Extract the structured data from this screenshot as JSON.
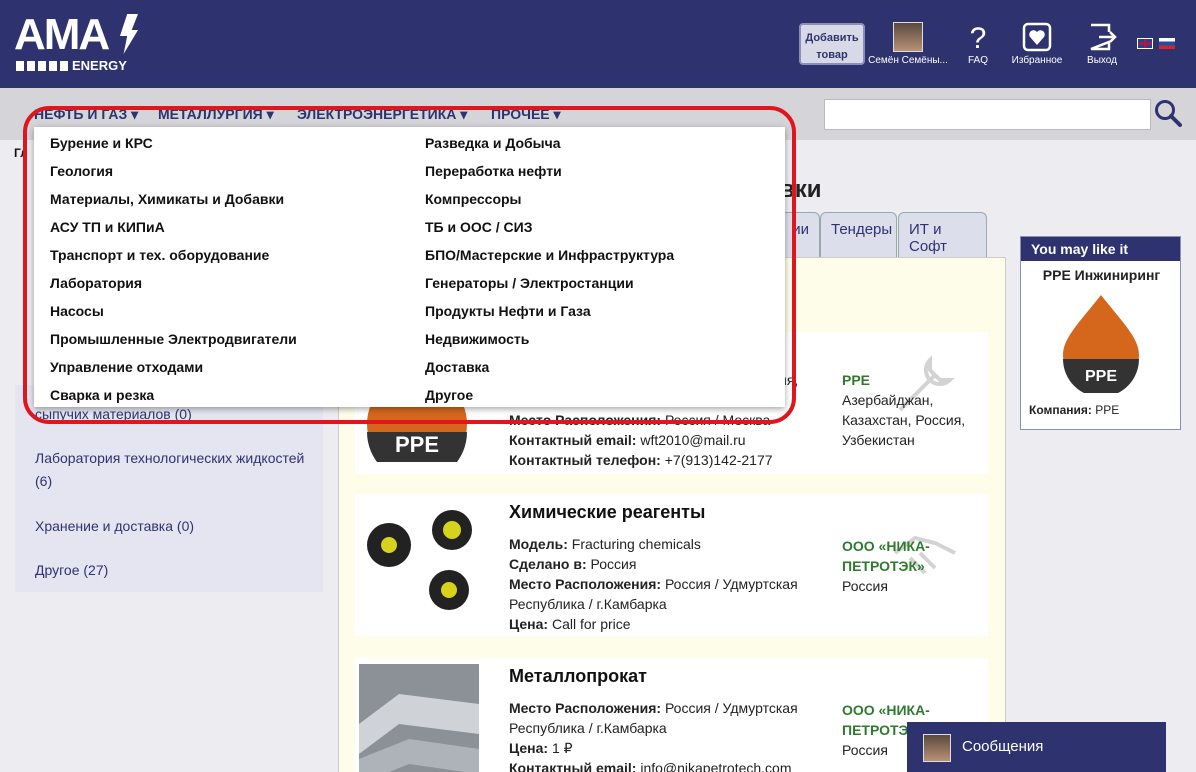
{
  "header": {
    "logo_text": "AMA",
    "logo_sub": "ENERGY",
    "add_product": "Добавить товар",
    "user_name": "Семён Семёны...",
    "faq": "FAQ",
    "favorites": "Избранное",
    "logout": "Выход",
    "colors": {
      "bg": "#2e3370"
    }
  },
  "nav": {
    "items": [
      "НЕФТЬ И ГАЗ",
      "МЕТАЛЛУРГИЯ",
      "ЭЛЕКТРОЭНЕРГЕТИКА",
      "ПРОЧЕЕ"
    ],
    "search_value": ""
  },
  "breadcrumb": "Гл",
  "dropdown": {
    "left": [
      "Бурение и КРС",
      "Геология",
      "Материалы, Химикаты и Добавки",
      "АСУ ТП и КИПиА",
      "Транспорт и тех. оборудование",
      "Лаборатория",
      "Насосы",
      "Промышленные Электродвигатели",
      "Управление отходами",
      "Сварка и резка"
    ],
    "right": [
      "Разведка и Добыча",
      "Переработка нефти",
      "Компрессоры",
      "ТБ и ООС / СИЗ",
      "БПО/Мастерские и Инфраструктура",
      "Генераторы / Электростанции",
      "Продукты Нефти и Газа",
      "Недвижимость",
      "Доставка",
      "Другое"
    ]
  },
  "sidebar": {
    "items": [
      "сыпучих материалов (0)",
      "Лаборатория технологических жидкостей (6)",
      "Хранение и доставка (0)",
      "Другое (27)"
    ]
  },
  "main": {
    "title_fragment": "вки",
    "tab_fragment": "ии",
    "tabs": [
      "Тендеры",
      "ИТ и Софт"
    ]
  },
  "cards": [
    {
      "title": "",
      "country_fragment": "ссия,",
      "fields": [
        {
          "label": "Место Расположения:",
          "value": "Россия / Москва"
        },
        {
          "label": "Контактный email:",
          "value": "wft2010@mail.ru"
        },
        {
          "label": "Контактный телефон:",
          "value": "+7(913)142-2177"
        }
      ],
      "company": "PPE",
      "countries": "Азербайджан, Казахстан, Россия, Узбекистан",
      "logo_text": "PPE"
    },
    {
      "title": "Химические реагенты",
      "fields": [
        {
          "label": "Модель:",
          "value": "Fracturing chemicals"
        },
        {
          "label": "Сделано в:",
          "value": "Россия"
        },
        {
          "label": "Место Расположения:",
          "value": "Россия / Удмуртская Республика / г.Камбарка"
        },
        {
          "label": "Цена:",
          "value": "Call for price"
        }
      ],
      "company": "ООО «НИКА-ПЕТРОТЭК»",
      "countries": "Россия"
    },
    {
      "title": "Металлопрокат",
      "fields": [
        {
          "label": "Место Расположения:",
          "value": "Россия / Удмуртская Республика / г.Камбарка"
        },
        {
          "label": "Цена:",
          "value": "1 ₽"
        },
        {
          "label": "Контактный email:",
          "value": "info@nikapetrotech.com"
        }
      ],
      "company": "ООО «НИКА-ПЕТРОТЭ",
      "countries": "Россия"
    }
  ],
  "ad": {
    "header": "You may like it",
    "title": "PPE Инжиниринг",
    "logo_text": "PPE",
    "company_label": "Компания:",
    "company_value": "PPE"
  },
  "messages": "Сообщения"
}
